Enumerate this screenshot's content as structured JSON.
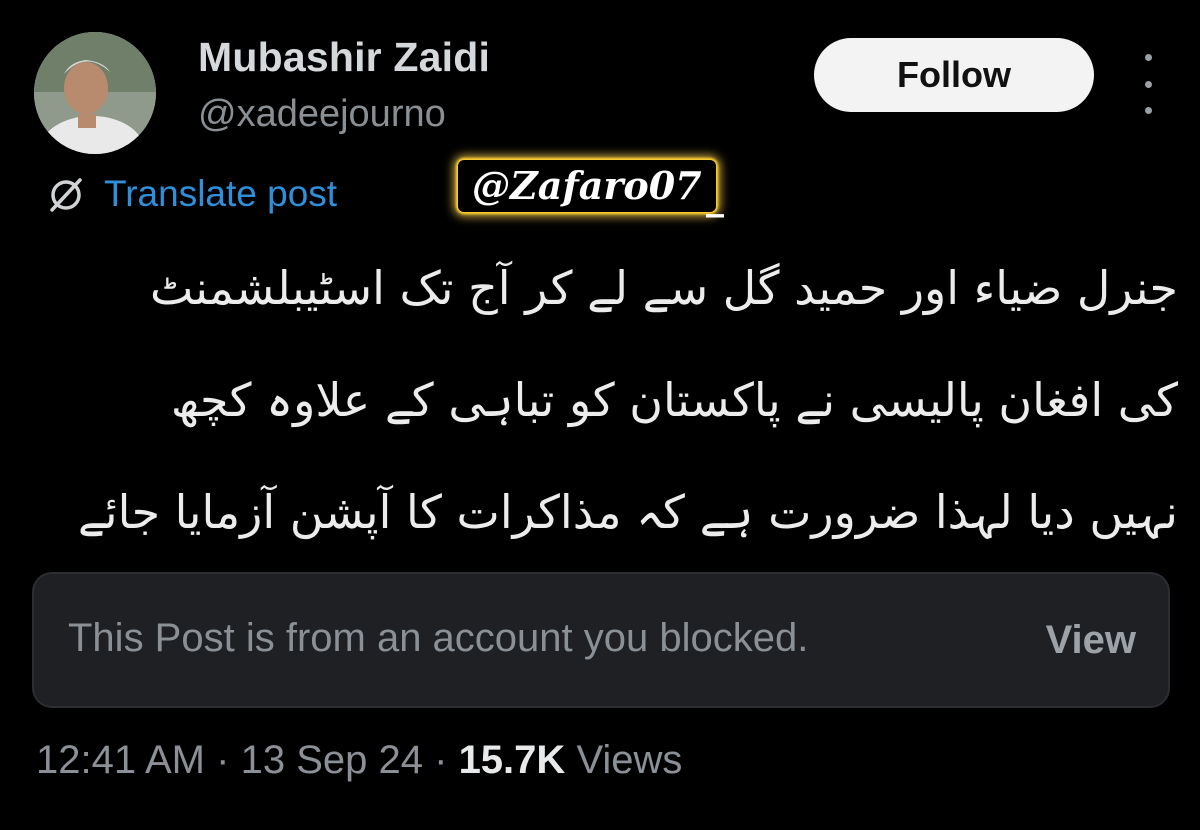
{
  "author": {
    "display_name": "Mubashir Zaidi",
    "handle": "@xadeejourno"
  },
  "header": {
    "follow_label": "Follow",
    "more_icon": "more-vertical-icon"
  },
  "translate": {
    "label": "Translate post",
    "icon": "translate-icon"
  },
  "watermark": {
    "text": "@Zafaro07",
    "tail": "_"
  },
  "post": {
    "lines": [
      "جنرل ضیاء اور حمید گل سے لے کر آج تک اسٹیبلشمنٹ",
      "کی افغان پالیسی نے پاکستان کو تباہی کے علاوہ کچھ",
      "نہیں دیا لہذا ضرورت ہے کہ مذاکرات کا آپشن آزمایا جائے"
    ]
  },
  "blocked_quote": {
    "message": "This Post is from an account you blocked.",
    "view_label": "View"
  },
  "meta": {
    "time": "12:41 AM",
    "separator": "·",
    "date": "13 Sep 24",
    "views_count": "15.7K",
    "views_label": "Views"
  },
  "colors": {
    "background": "#000000",
    "link": "#2f90d9",
    "card": "#1e2023",
    "muted_text": "#8a9096",
    "watermark_glow": "#ffd200"
  }
}
